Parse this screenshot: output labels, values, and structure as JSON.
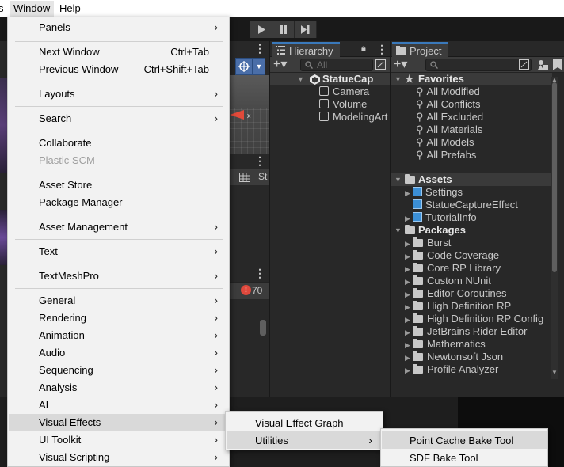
{
  "menubar": {
    "items": [
      {
        "label": "s"
      },
      {
        "label": "Window"
      },
      {
        "label": "Help"
      }
    ]
  },
  "window_menu": {
    "panels": "Panels",
    "next_window": "Next Window",
    "next_window_shortcut": "Ctrl+Tab",
    "previous_window": "Previous Window",
    "previous_window_shortcut": "Ctrl+Shift+Tab",
    "layouts": "Layouts",
    "search": "Search",
    "collaborate": "Collaborate",
    "plastic_scm": "Plastic SCM",
    "asset_store": "Asset Store",
    "package_manager": "Package Manager",
    "asset_management": "Asset Management",
    "text": "Text",
    "textmeshpro": "TextMeshPro",
    "general": "General",
    "rendering": "Rendering",
    "animation": "Animation",
    "audio": "Audio",
    "sequencing": "Sequencing",
    "analysis": "Analysis",
    "ai": "AI",
    "visual_effects": "Visual Effects",
    "ui_toolkit": "UI Toolkit",
    "visual_scripting": "Visual Scripting"
  },
  "visual_effects_menu": {
    "visual_effect_graph": "Visual Effect Graph",
    "utilities": "Utilities"
  },
  "utilities_menu": {
    "point_cache_bake_tool": "Point Cache Bake Tool",
    "sdf_bake_tool": "SDF Bake Tool"
  },
  "hierarchy": {
    "tab_label": "Hierarchy",
    "search_placeholder": "All",
    "root": "StatueCap",
    "children": [
      "Camera",
      "Volume",
      "ModelingArt"
    ]
  },
  "project": {
    "tab_label": "Project",
    "favorites_label": "Favorites",
    "favorites": [
      "All Modified",
      "All Conflicts",
      "All Excluded",
      "All Materials",
      "All Models",
      "All Prefabs"
    ],
    "assets_label": "Assets",
    "assets": [
      "Settings",
      "StatueCaptureEffect",
      "TutorialInfo"
    ],
    "packages_label": "Packages",
    "packages": [
      "Burst",
      "Code Coverage",
      "Core RP Library",
      "Custom NUnit",
      "Editor Coroutines",
      "High Definition RP",
      "High Definition RP Config",
      "JetBrains Rider Editor",
      "Mathematics",
      "Newtonsoft Json",
      "Profile Analyzer"
    ]
  },
  "scene": {
    "tool_text": "St",
    "console_count": "70",
    "console_badge": "!"
  },
  "colors": {
    "accent_tab": "#3a79bb",
    "error": "#e0493d",
    "menu_bg": "#f2f2f2",
    "menu_highlight": "#d9d9d9"
  }
}
